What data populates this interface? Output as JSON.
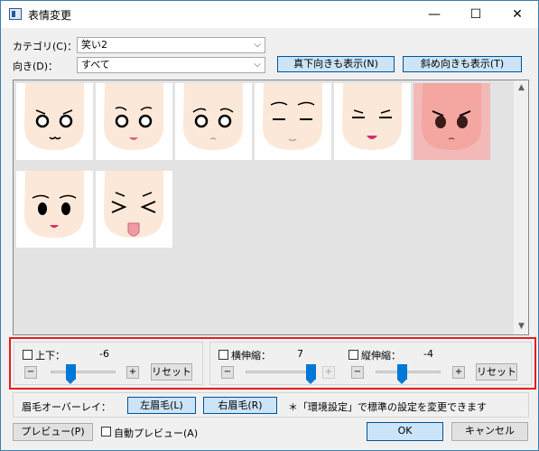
{
  "window": {
    "title": "表情変更",
    "controls": [
      "—",
      "☐",
      "✕"
    ]
  },
  "filters": {
    "category_label": "カテゴリ(C)：",
    "category_value": "笑い2",
    "direction_label": "向き(D)：",
    "direction_value": "すべて",
    "show_down_button": "真下向きも表示(N)",
    "show_diagonal_button": "斜め向きも表示(T)"
  },
  "faces": [
    {
      "expression": "dot-eyes-smirk",
      "selected": false
    },
    {
      "expression": "worried-dot-eyes",
      "selected": false
    },
    {
      "expression": "sad-dot-eyes",
      "selected": false
    },
    {
      "expression": "closed-eyes-smile",
      "selected": false
    },
    {
      "expression": "closed-eyes-open-smile",
      "selected": false
    },
    {
      "expression": "angry-dark-eyes",
      "selected": true
    },
    {
      "expression": "sleepy-black-eyes",
      "selected": false
    },
    {
      "expression": "xd-tongue-out",
      "selected": false
    }
  ],
  "adjust": {
    "updown_label": "上下：",
    "updown_value": "-6",
    "updown_level": 0.3,
    "horizontal_label": "横伸縮：",
    "horizontal_value": "7",
    "horizontal_level": 1.0,
    "vertical_label": "縦伸縮：",
    "vertical_value": "-4",
    "vertical_level": 0.4,
    "reset_label": "リセット",
    "minus_label": "−",
    "plus_label": "+"
  },
  "eyebrow": {
    "label": "眉毛オーバーレイ：",
    "left_button": "左眉毛(L)",
    "right_button": "右眉毛(R)",
    "note": "＊「環境設定」で標準の設定を変更できます"
  },
  "footer": {
    "preview_button": "プレビュー(P)",
    "auto_preview_label": "自動プレビュー(A)",
    "ok_button": "OK",
    "cancel_button": "キャンセル"
  },
  "colors": {
    "accent": "#0078d7",
    "highlight_frame": "#e81c1c",
    "selected_cell": "#f3b9b9",
    "skin": "#fce8d8"
  }
}
